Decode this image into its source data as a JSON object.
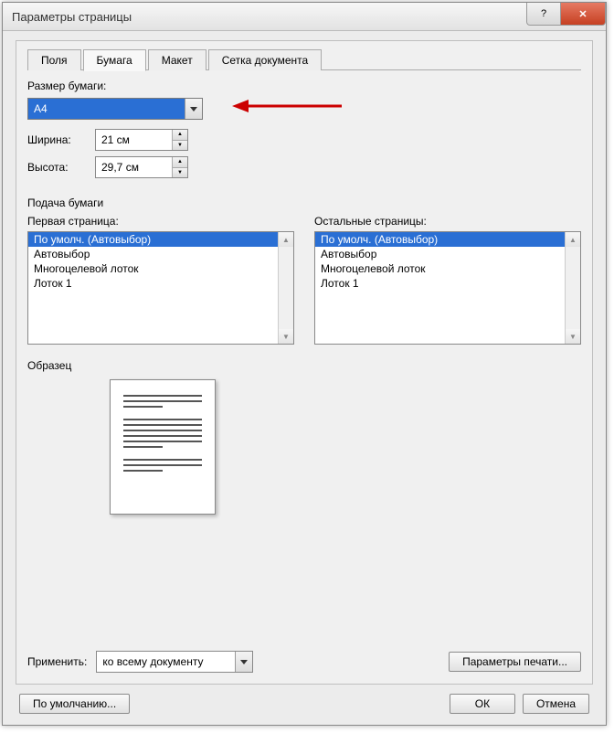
{
  "window": {
    "title": "Параметры страницы"
  },
  "tabs": {
    "fields": "Поля",
    "paper": "Бумага",
    "layout": "Макет",
    "grid": "Сетка документа"
  },
  "paper_size": {
    "label": "Размер бумаги:",
    "value": "A4",
    "width_label": "Ширина:",
    "width_value": "21 см",
    "height_label": "Высота:",
    "height_value": "29,7 см"
  },
  "feed": {
    "group_label": "Подача бумаги",
    "first_page_label": "Первая страница:",
    "other_pages_label": "Остальные страницы:",
    "options": [
      "По умолч. (Автовыбор)",
      "Автовыбор",
      "Многоцелевой лоток",
      "Лоток 1"
    ]
  },
  "preview": {
    "label": "Образец"
  },
  "apply": {
    "label": "Применить:",
    "value": "ко всему документу",
    "print_params": "Параметры печати..."
  },
  "buttons": {
    "defaults": "По умолчанию...",
    "ok": "ОК",
    "cancel": "Отмена"
  }
}
